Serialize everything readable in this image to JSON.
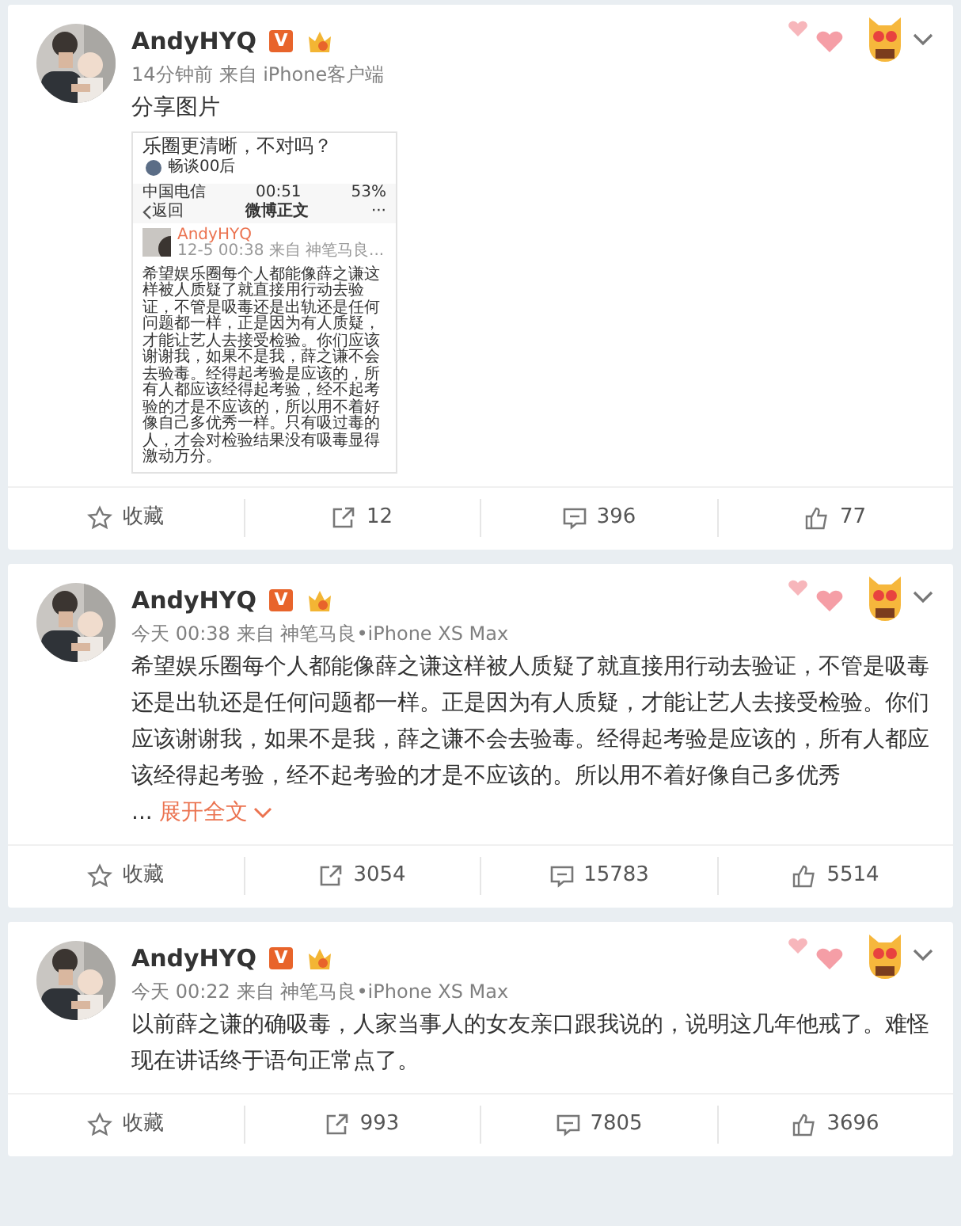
{
  "posts": [
    {
      "author": "AndyHYQ",
      "verified_badge": "V",
      "time": "14分钟前",
      "source": "来自 iPhone客户端",
      "text": "分享图片",
      "truncated": false,
      "attachment": {
        "kind": "screenshot",
        "headline": "乐圈更清晰，不对吗？",
        "account": "畅谈00后",
        "status_bar": {
          "carrier": "中国电信",
          "time": "00:51",
          "battery": "53%"
        },
        "nav": {
          "back": "返回",
          "title": "微博正文",
          "more": "···"
        },
        "inner_post": {
          "author": "AndyHYQ",
          "meta": "12-5 00:38 来自 神笔马良...",
          "text": "希望娱乐圈每个人都能像薛之谦这样被人质疑了就直接用行动去验证，不管是吸毒还是出轨还是任何问题都一样，正是因为有人质疑，才能让艺人去接受检验。你们应该谢谢我，如果不是我，薛之谦不会去验毒。经得起考验是应该的，所有人都应该经得起考验，经不起考验的才是不应该的，所以用不着好像自己多优秀一样。只有吸过毒的人，才会对检验结果没有吸毒显得激动万分。"
        }
      },
      "actions": [
        {
          "kind": "favorite",
          "label": "收藏"
        },
        {
          "kind": "repost",
          "label": "12"
        },
        {
          "kind": "comment",
          "label": "396"
        },
        {
          "kind": "like",
          "label": "77"
        }
      ]
    },
    {
      "author": "AndyHYQ",
      "verified_badge": "V",
      "time": "今天 00:38",
      "source": "来自 神笔马良•iPhone XS Max",
      "text": "希望娱乐圈每个人都能像薛之谦这样被人质疑了就直接用行动去验证，不管是吸毒还是出轨还是任何问题都一样。正是因为有人质疑，才能让艺人去接受检验。你们应该谢谢我，如果不是我，薛之谦不会去验毒。经得起考验是应该的，所有人都应该经得起考验，经不起考验的才是不应该的。所以用不着好像自己多优秀",
      "truncated": true,
      "ellipsis": "...",
      "expand": "展开全文",
      "actions": [
        {
          "kind": "favorite",
          "label": "收藏"
        },
        {
          "kind": "repost",
          "label": "3054"
        },
        {
          "kind": "comment",
          "label": "15783"
        },
        {
          "kind": "like",
          "label": "5514"
        }
      ]
    },
    {
      "author": "AndyHYQ",
      "verified_badge": "V",
      "time": "今天 00:22",
      "source": "来自 神笔马良•iPhone XS Max",
      "text": "以前薛之谦的确吸毒，人家当事人的女友亲口跟我说的，说明这几年他戒了。难怪现在讲话终于语句正常点了。",
      "truncated": false,
      "actions": [
        {
          "kind": "favorite",
          "label": "收藏"
        },
        {
          "kind": "repost",
          "label": "993"
        },
        {
          "kind": "comment",
          "label": "7805"
        },
        {
          "kind": "like",
          "label": "3696"
        }
      ]
    }
  ]
}
